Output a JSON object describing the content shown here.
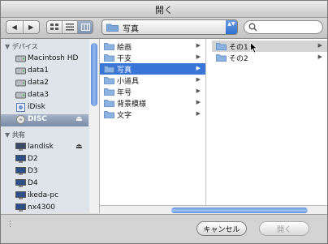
{
  "window": {
    "title": "開く"
  },
  "toolbar": {
    "nav": {
      "back": "◀",
      "forward": "▶"
    },
    "view_modes": [
      "icon-view",
      "list-view",
      "column-view"
    ],
    "location": {
      "label": "写真",
      "arrows": "▲▼"
    },
    "search": {
      "placeholder": ""
    }
  },
  "sidebar": {
    "devices_header": "デバイス",
    "devices": [
      {
        "label": "Macintosh HD",
        "icon": "hard-disk-icon"
      },
      {
        "label": "data1",
        "icon": "hard-disk-icon"
      },
      {
        "label": "data2",
        "icon": "hard-disk-icon"
      },
      {
        "label": "data3",
        "icon": "hard-disk-icon"
      },
      {
        "label": "iDisk",
        "icon": "idisk-icon"
      },
      {
        "label": "DISC",
        "icon": "disc-icon",
        "selected": true,
        "eject": "⏏"
      }
    ],
    "shared_header": "共有",
    "shared": [
      {
        "label": "landisk",
        "icon": "network-computer-icon",
        "eject": "⏏"
      },
      {
        "label": "D2",
        "icon": "monitor-icon"
      },
      {
        "label": "D3",
        "icon": "monitor-icon"
      },
      {
        "label": "D4",
        "icon": "monitor-icon"
      },
      {
        "label": "ikeda-pc",
        "icon": "monitor-icon"
      },
      {
        "label": "nx4300",
        "icon": "monitor-icon"
      }
    ]
  },
  "browser": {
    "column1": [
      {
        "label": "絵画"
      },
      {
        "label": "干支"
      },
      {
        "label": "写真",
        "selected": true
      },
      {
        "label": "小道具"
      },
      {
        "label": "年号"
      },
      {
        "label": "背景模様"
      },
      {
        "label": "文字"
      }
    ],
    "column2": [
      {
        "label": "その1",
        "highlighted": true
      },
      {
        "label": "その2"
      }
    ],
    "arrow": "▶"
  },
  "buttons": {
    "cancel": "キャンセル",
    "open": "開く"
  },
  "colors": {
    "selection": "#3875d7",
    "sidebar_bg": "#dfe4ea",
    "scroll_thumb": "#5f8fdc"
  }
}
